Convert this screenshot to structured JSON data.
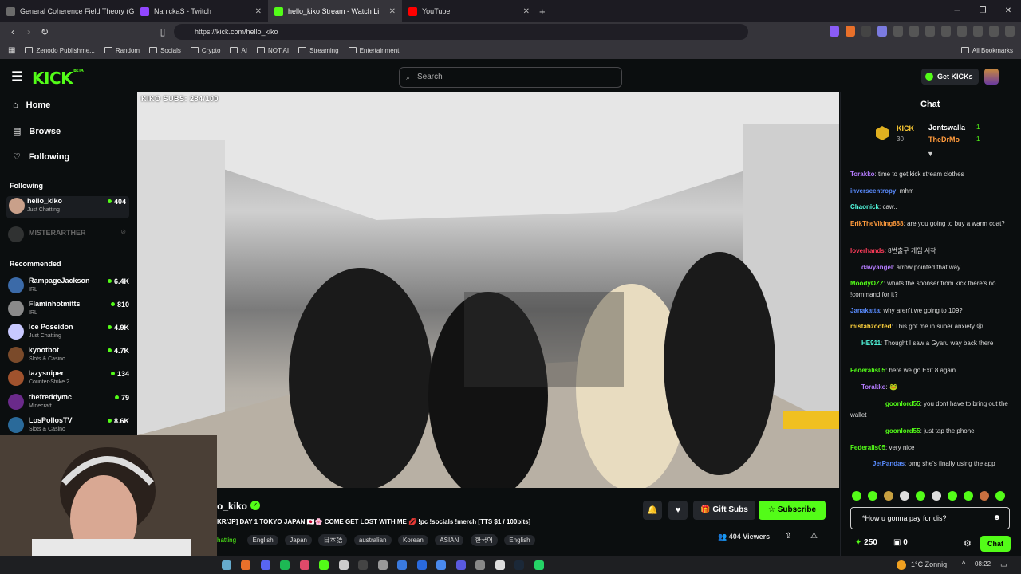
{
  "browser": {
    "tabs": [
      {
        "title": "General Coherence Field Theory (GC",
        "color": "#6b6b6b"
      },
      {
        "title": "NanickaS - Twitch",
        "color": "#9146ff"
      },
      {
        "title": "hello_kiko Stream - Watch Li",
        "color": "#53fc18"
      },
      {
        "title": "YouTube",
        "color": "#ff0000"
      }
    ],
    "url": "https://kick.com/hello_kiko",
    "bookmarks": [
      "Zenodo Publishme...",
      "Random",
      "Socials",
      "Crypto",
      "AI",
      "NOT AI",
      "Streaming",
      "Entertainment"
    ],
    "all_bookmarks": "All Bookmarks"
  },
  "kick": {
    "logo": "KICK",
    "logo_badge": "BETA",
    "search_placeholder": "Search",
    "get_kicks": "Get KICKs"
  },
  "sidebar": {
    "nav": [
      {
        "label": "Home",
        "icon": "home-icon"
      },
      {
        "label": "Browse",
        "icon": "browse-icon"
      },
      {
        "label": "Following",
        "icon": "heart-icon"
      }
    ],
    "following_header": "Following",
    "following": [
      {
        "name": "hello_kiko",
        "category": "Just Chatting",
        "viewers": "404",
        "color": "#c9a08a"
      },
      {
        "name": "MISTERARTHER",
        "category": "",
        "viewers": "",
        "color": "#555"
      }
    ],
    "recommended_header": "Recommended",
    "recommended": [
      {
        "name": "RampageJackson",
        "category": "IRL",
        "viewers": "6.4K",
        "color": "#3b6aa8"
      },
      {
        "name": "Flaminhotmitts",
        "category": "IRL",
        "viewers": "810",
        "color": "#8a8a8a"
      },
      {
        "name": "Ice Poseidon",
        "category": "Just Chatting",
        "viewers": "4.9K",
        "color": "#c8c8ff"
      },
      {
        "name": "kyootbot",
        "category": "Slots & Casino",
        "viewers": "4.7K",
        "color": "#7a4a2a"
      },
      {
        "name": "lazysniper",
        "category": "Counter-Strike 2",
        "viewers": "134",
        "color": "#a0522d"
      },
      {
        "name": "thefreddymc",
        "category": "Minecraft",
        "viewers": "79",
        "color": "#6a2a8a"
      },
      {
        "name": "LosPollosTV",
        "category": "Slots & Casino",
        "viewers": "8.6K",
        "color": "#2a6a9a"
      }
    ]
  },
  "stream": {
    "overlay": "KIKO SUBS: 284/100",
    "channel": "hello_kiko",
    "channel_visible": "o_kiko",
    "title": "KR/JP] DAY 1 TOKYO JAPAN 🇯🇵🌸 COME GET LOST WITH ME 💋 !pc !socials !merch [TTS $1 / 100bits]",
    "category": "hatting",
    "tags": [
      "English",
      "Japan",
      "日本語",
      "australian",
      "Korean",
      "ASIAN",
      "한국어",
      "English"
    ],
    "gift_subs": "Gift Subs",
    "subscribe": "Subscribe",
    "viewers": "404 Viewers"
  },
  "chat": {
    "header": "Chat",
    "pinned": {
      "label": "KICK",
      "count": "30",
      "users": [
        {
          "name": "Jontswalla",
          "n": "1"
        },
        {
          "name": "TheDrMo",
          "n": "1"
        }
      ]
    },
    "messages": [
      {
        "user": "Torakko",
        "color": "#b57cff",
        "text": ": time to get kick stream clothes"
      },
      {
        "user": "inverseentropy",
        "color": "#5a8cff",
        "text": ": mhm"
      },
      {
        "user": "Chaonick",
        "color": "#53fce0",
        "text": ": caw.."
      },
      {
        "user": "ErikTheViking888",
        "color": "#ff9a3c",
        "text": ": are you going to buy a warm coat?"
      },
      {
        "user": "loverhands",
        "color": "#ff3c5a",
        "text": ": 8번출구 게임 시작"
      },
      {
        "user": "davyangel",
        "color": "#b57cff",
        "text": ": arrow pointed that way"
      },
      {
        "user": "MoodyOZZ",
        "color": "#53fc18",
        "text": ": whats the sponser from kick there's no !command for it?"
      },
      {
        "user": "Janakatta",
        "color": "#5a8cff",
        "text": ": why aren't we going to 109?"
      },
      {
        "user": "mistahzooted",
        "color": "#ffd23c",
        "text": ": This got me in super anxiety 😩"
      },
      {
        "user": "HE911",
        "color": "#53fce0",
        "text": ": Thought I saw a Gyaru way back there"
      },
      {
        "user": "Federalis05",
        "color": "#53fc18",
        "text": ": here we go Exit 8 again"
      },
      {
        "user": "Torakko",
        "color": "#b57cff",
        "text": ": 🐸"
      },
      {
        "user": "goonlord55",
        "color": "#53fc18",
        "text": ": you dont have to bring out the wallet"
      },
      {
        "user": "goonlord55",
        "color": "#53fc18",
        "text": ": just tap the phone"
      },
      {
        "user": "Federalis05",
        "color": "#53fc18",
        "text": ": very nice"
      },
      {
        "user": "JetPandas",
        "color": "#5a8cff",
        "text": ": omg she's finally using the app"
      }
    ],
    "input_value": "*How u gonna pay for dis?",
    "points": "250",
    "gift_count": "0",
    "send": "Chat"
  },
  "taskbar": {
    "weather": "1°C  Zonnig",
    "time": "08:22"
  },
  "colors": {
    "accent": "#53fc18",
    "bg": "#0b0e0f",
    "panel": "#24272c"
  }
}
